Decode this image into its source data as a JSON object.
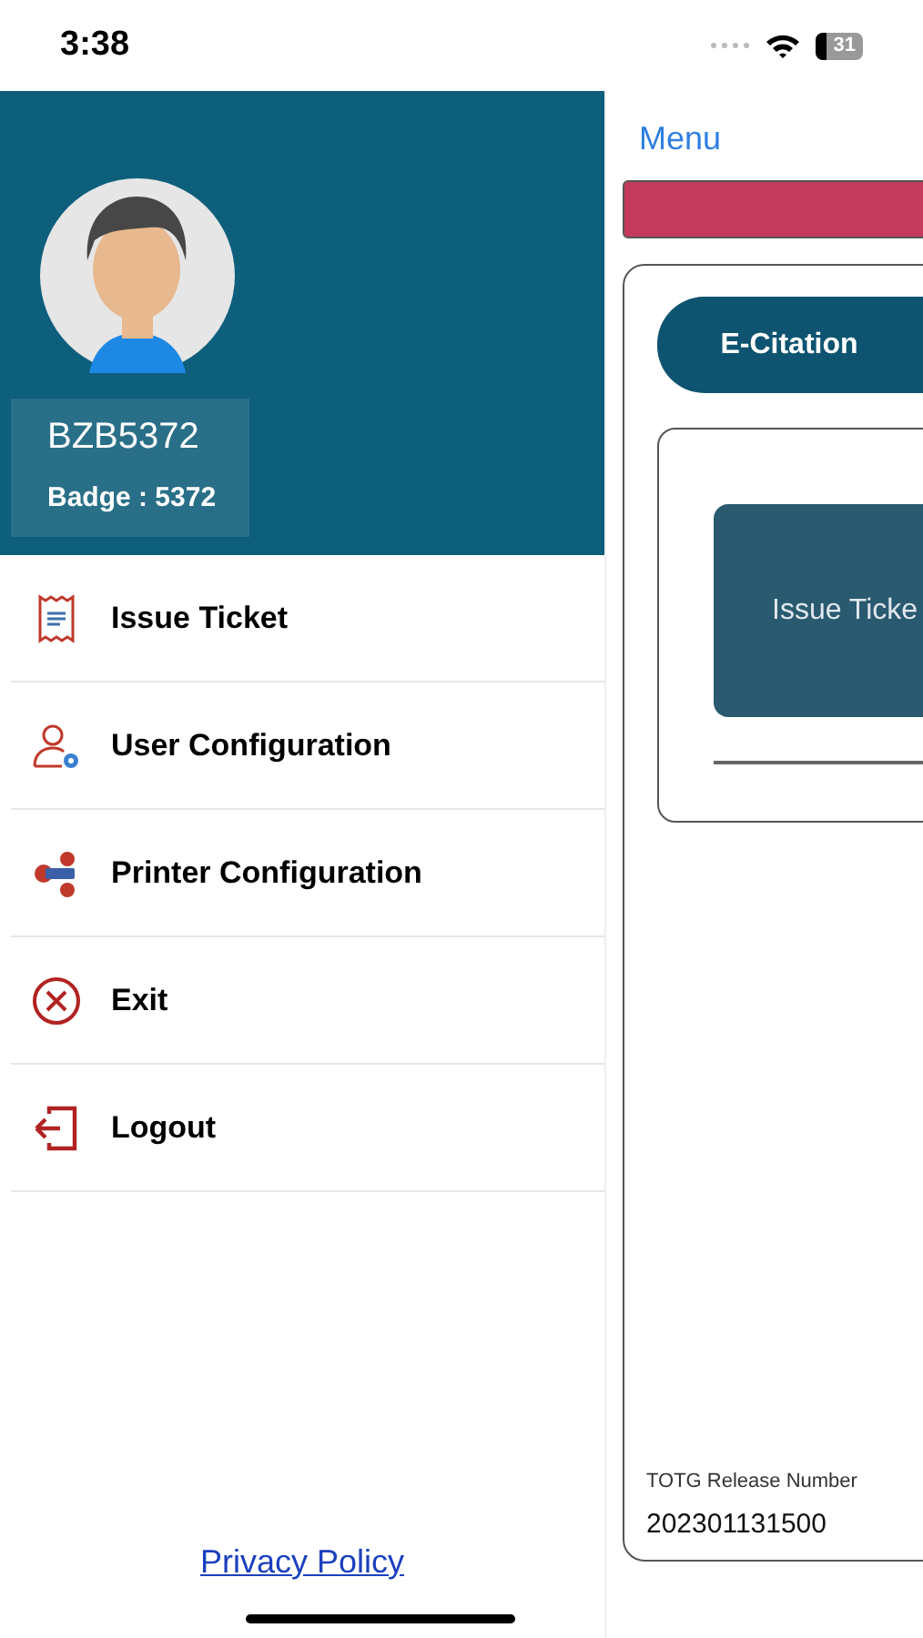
{
  "status_bar": {
    "time": "3:38",
    "battery": "31"
  },
  "drawer": {
    "user": {
      "name": "BZB5372",
      "badge": "Badge : 5372"
    },
    "items": [
      {
        "label": "Issue Ticket"
      },
      {
        "label": "User Configuration"
      },
      {
        "label": "Printer Configuration"
      },
      {
        "label": "Exit"
      },
      {
        "label": "Logout"
      }
    ],
    "privacy_link": "Privacy Policy"
  },
  "main": {
    "menu_button": "Menu",
    "tab": "E-Citation",
    "tile": "Issue Ticke",
    "release_label": "TOTG Release Number",
    "release_number": "202301131500"
  }
}
